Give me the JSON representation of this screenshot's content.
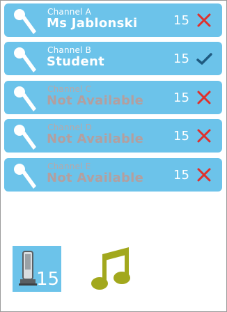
{
  "channels": [
    {
      "name": "Channel A",
      "status": "Ms Jablonski",
      "level": "15",
      "mark": "red-x-icon",
      "available": true
    },
    {
      "name": "Channel B",
      "status": "Student",
      "level": "15",
      "mark": "checkmark-icon",
      "available": true
    },
    {
      "name": "Channel C",
      "status": "Not Available",
      "level": "15",
      "mark": "red-x-icon",
      "available": false
    },
    {
      "name": "Channel D",
      "status": "Not Available",
      "level": "15",
      "mark": "red-x-icon",
      "available": false
    },
    {
      "name": "Channel E",
      "status": "Not Available",
      "level": "15",
      "mark": "red-x-icon",
      "available": false
    }
  ],
  "bottom": {
    "device_count": "15",
    "device_icon": "speaker-device-icon",
    "music_icon": "music-note-icon"
  },
  "colors": {
    "channel_bg": "#6cc3ea",
    "text_active": "#ffffff",
    "text_inactive": "#b39f9f",
    "x_color": "#e0302b",
    "check_color": "#1f5a80",
    "music_color": "#a2a81d"
  }
}
